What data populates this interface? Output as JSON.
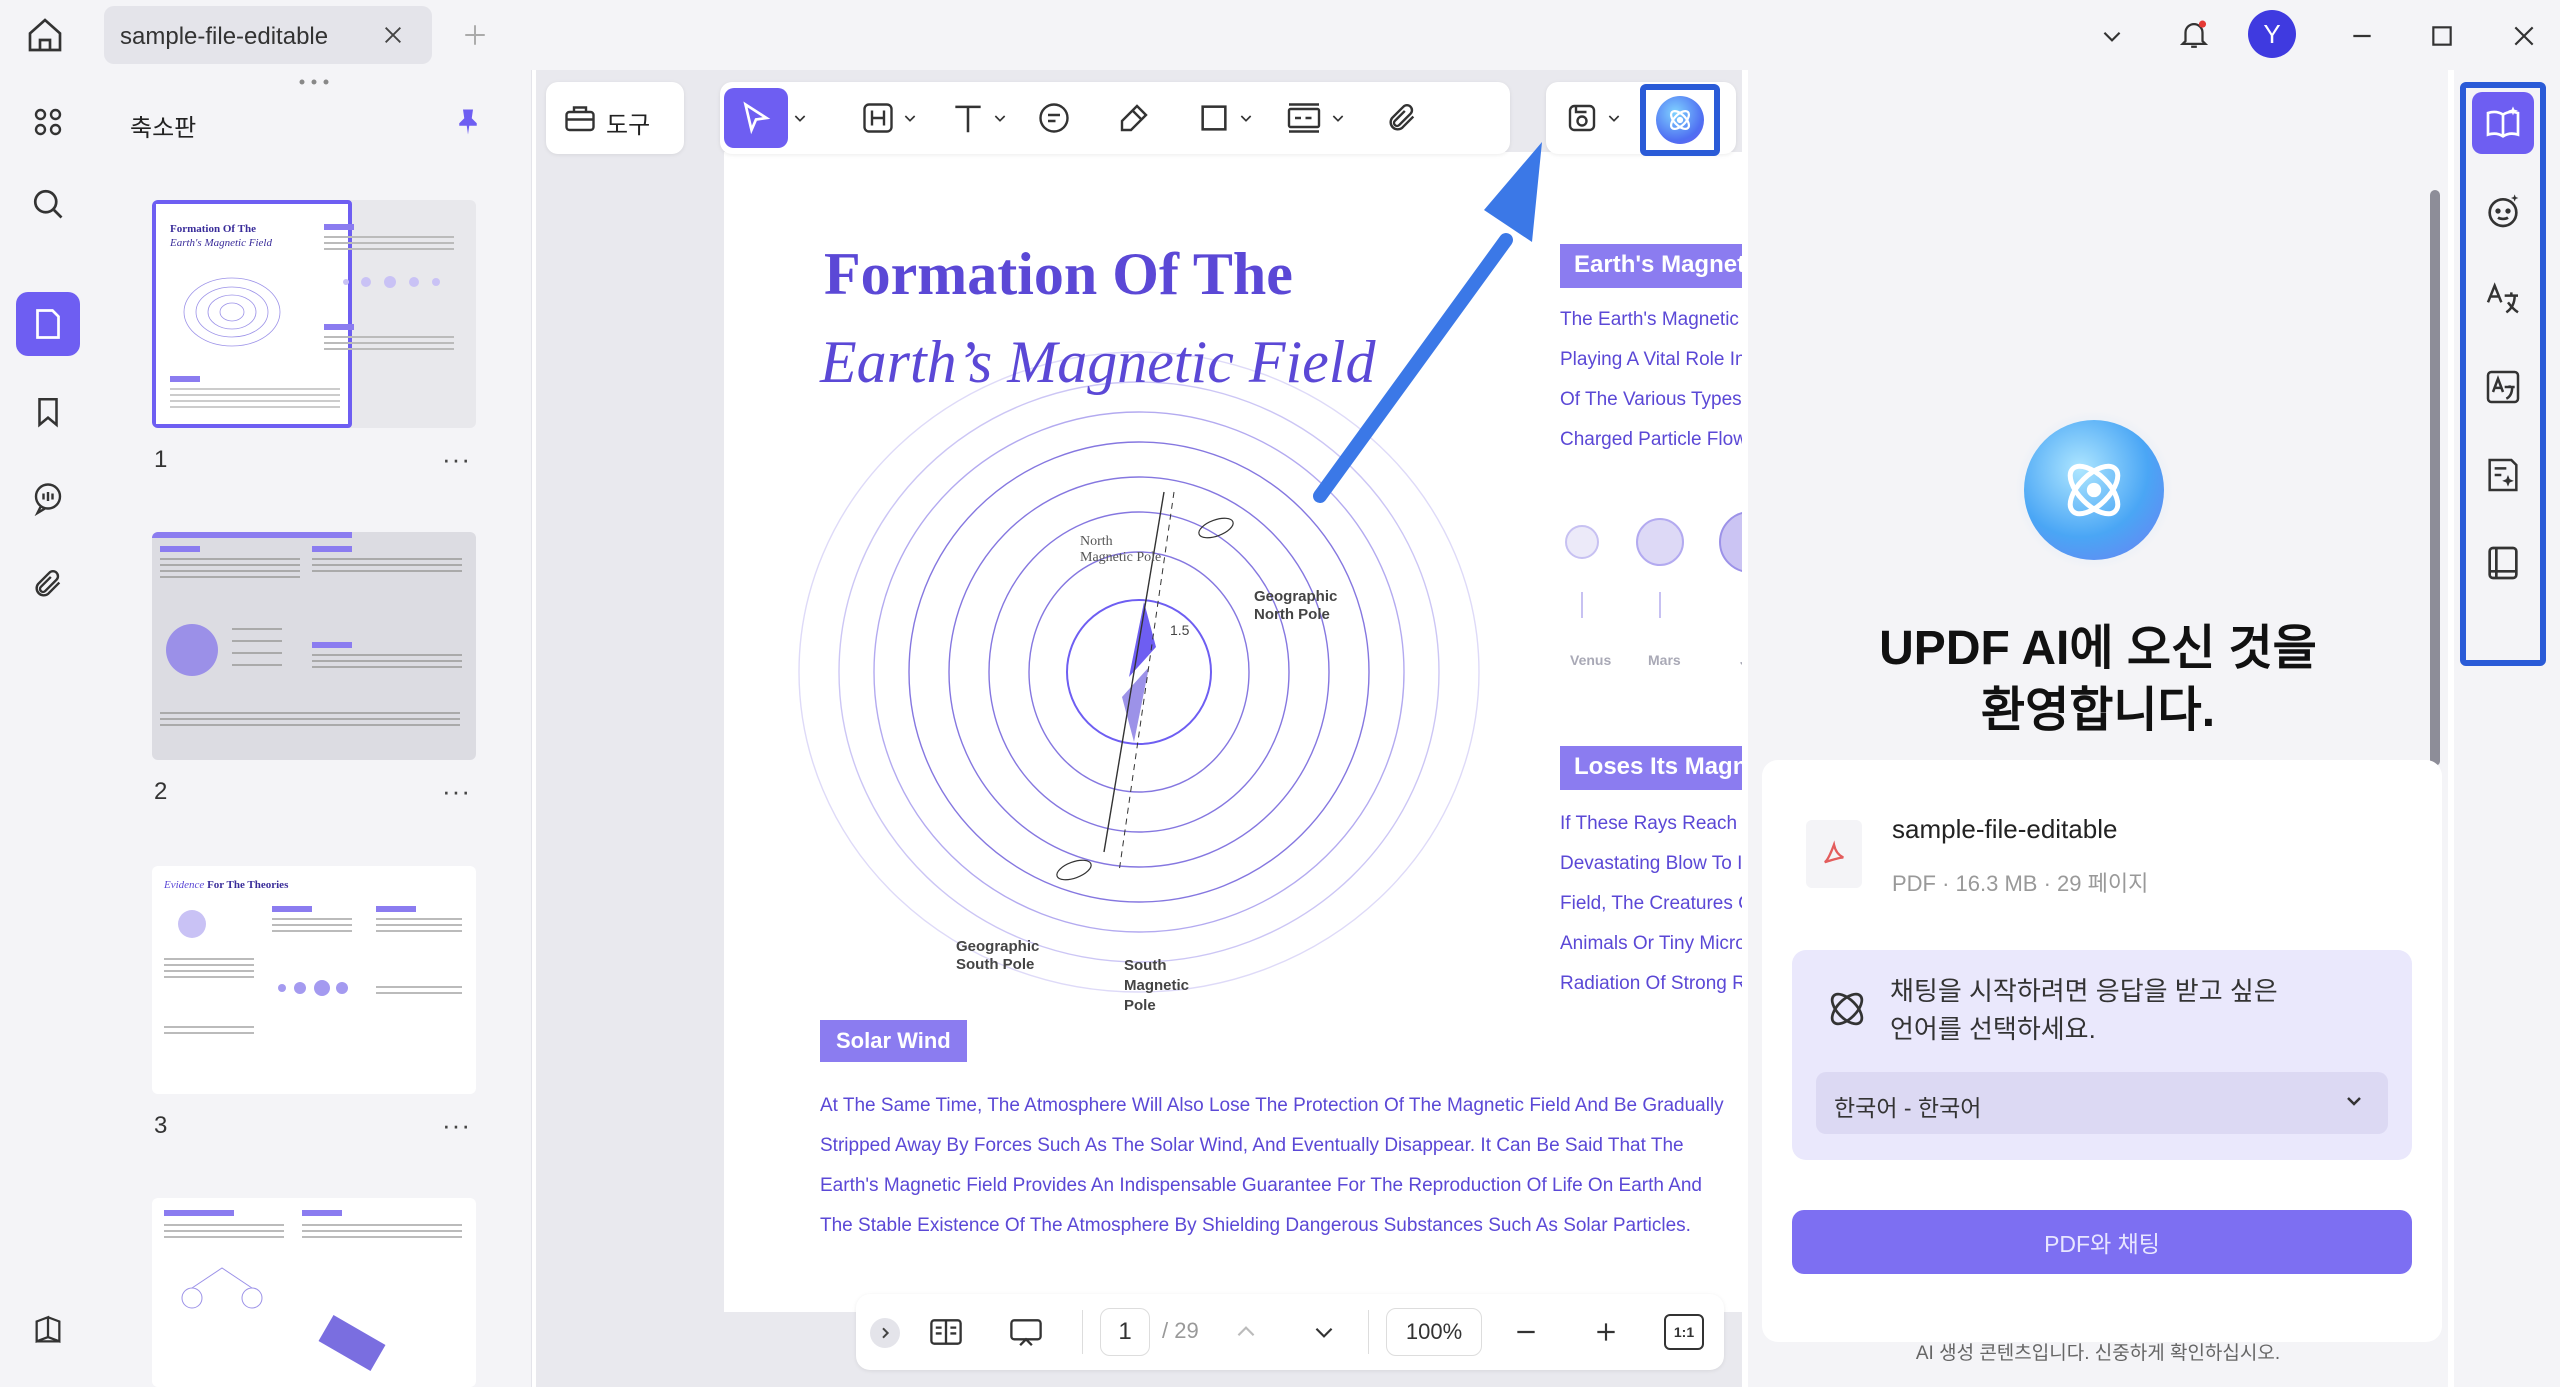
{
  "window": {
    "tab_title": "sample-file-editable",
    "avatar_letter": "Y"
  },
  "sidebar": {
    "panel_title": "축소판",
    "pages": [
      {
        "number": "1"
      },
      {
        "number": "2"
      },
      {
        "number": "3"
      }
    ]
  },
  "toolbar": {
    "tools_label": "도구"
  },
  "document": {
    "title_line1": "Formation Of The",
    "title_line2": "Earth’s Magnetic Field",
    "diagram_labels": {
      "north_magnetic": "North\nMagnetic Pole",
      "geo_north": "Geographic\nNorth Pole",
      "angle": "1.5",
      "geo_south": "Geographic\nSouth Pole",
      "south_magnetic": "South\nMagnetic\nPole"
    },
    "section1_heading": "Earth's Magnetic",
    "section1_lines": [
      "The Earth's Magnetic",
      "Playing A Vital Role In",
      "Of The Various Types",
      "Charged Particle Flow"
    ],
    "planets": [
      "Venus",
      "Mars",
      "Ju"
    ],
    "section2_heading": "Loses Its Magne",
    "section2_lines": [
      "If These Rays Reach",
      "Devastating Blow To I",
      "Field, The Creatures C",
      "Animals Or Tiny Micro",
      "Radiation Of Strong R"
    ],
    "solar_heading": "Solar Wind",
    "solar_lines": [
      "At The Same Time, The Atmosphere Will Also Lose The Protection Of The Magnetic Field And Be Gradually",
      "Stripped Away By Forces Such As The Solar Wind, And Eventually Disappear. It Can Be Said That The",
      "Earth's Magnetic Field Provides An Indispensable Guarantee For The Reproduction Of Life On Earth And",
      "The Stable Existence Of The Atmosphere By Shielding Dangerous Substances Such As Solar Particles."
    ]
  },
  "bottom_bar": {
    "page_current": "1",
    "page_total": "/ 29",
    "zoom": "100%",
    "fit_label": "1:1"
  },
  "ai_panel": {
    "welcome_line1": "UPDF AI에 오신 것을",
    "welcome_line2": "환영합니다.",
    "file_name": "sample-file-editable",
    "file_meta": "PDF · 16.3 MB · 29 페이지",
    "language_prompt_line1": "채팅을 시작하려면 응답을 받고 싶은",
    "language_prompt_line2": "언어를 선택하세요.",
    "language_selected": "한국어 - 한국어",
    "chat_button": "PDF와 채팅",
    "disclaimer": "AI 생성 콘텐츠입니다. 신중하게 확인하십시오."
  },
  "colors": {
    "accent": "#6e5ef2",
    "doc_title": "#5b48d6",
    "heading_bg": "#8b7cf0",
    "highlight_border": "#2a5bd7",
    "arrow": "#3b78e7"
  }
}
